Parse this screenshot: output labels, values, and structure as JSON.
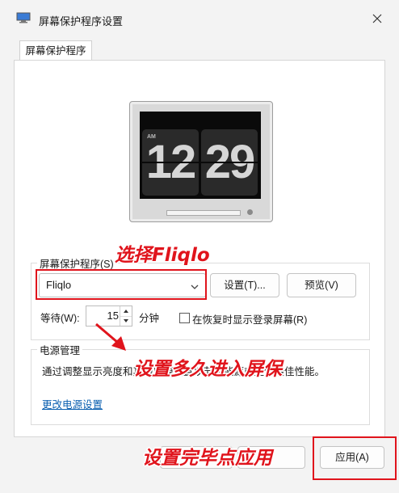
{
  "window": {
    "title": "屏幕保护程序设置"
  },
  "tab": {
    "label": "屏幕保护程序"
  },
  "preview": {
    "clock": {
      "ampm": "AM",
      "hours": "12",
      "minutes": "29"
    }
  },
  "screensaver": {
    "group_label": "屏幕保护程序(S)",
    "selected": "Fliqlo",
    "settings_label": "设置(T)...",
    "preview_label": "预览(V)",
    "wait_label": "等待(W):",
    "wait_value": "15",
    "wait_unit": "分钟",
    "resume_checkbox_label": "在恢复时显示登录屏幕(R)",
    "resume_checked": false
  },
  "power": {
    "group_label": "电源管理",
    "description": "通过调整显示亮度和其他电源设置以节省能源或提供最佳性能。",
    "link_label": "更改电源设置"
  },
  "footer": {
    "apply_label": "应用(A)"
  },
  "annotations": {
    "select_fliqlo": "选择Fliqlo",
    "set_wait": "设置多久进入屏保",
    "click_apply": "设置完毕点应用"
  },
  "colors": {
    "annotation": "#e0141c",
    "link": "#0a5fb0"
  },
  "icons": [
    "display-icon",
    "close-icon",
    "chevron-down-icon",
    "spin-up-icon",
    "spin-down-icon"
  ]
}
